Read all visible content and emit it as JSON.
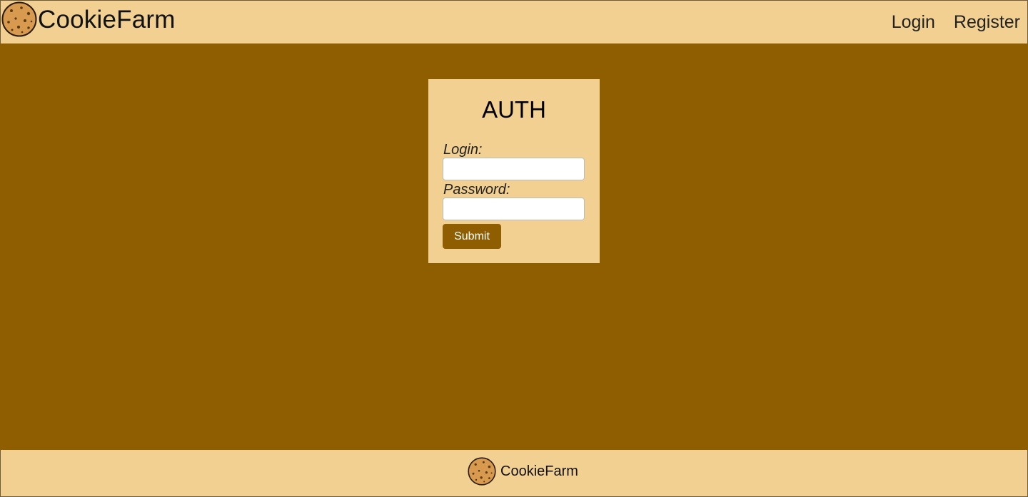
{
  "header": {
    "brand_name": "CookieFarm",
    "logo_icon": "cookie-icon",
    "nav": [
      {
        "label": "Login"
      },
      {
        "label": "Register"
      }
    ]
  },
  "auth": {
    "title": "AUTH",
    "login_label": "Login:",
    "login_value": "",
    "password_label": "Password:",
    "password_value": "",
    "submit_label": "Submit"
  },
  "footer": {
    "brand_name": "CookieFarm",
    "logo_icon": "cookie-icon"
  },
  "colors": {
    "background": "#8f5e00",
    "panel": "#f2d092",
    "button": "#8f5e00",
    "cookie": "#d89a4e",
    "chip": "#5a3a12"
  }
}
